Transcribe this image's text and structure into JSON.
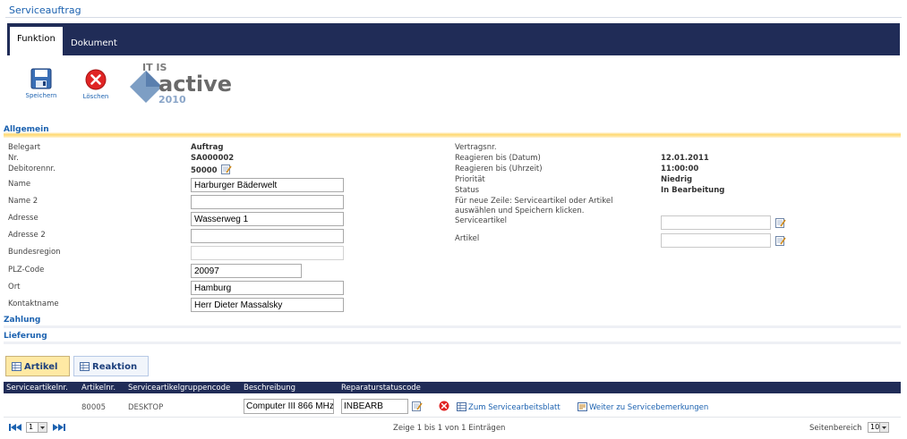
{
  "header": {
    "title": "Serviceauftrag"
  },
  "tabs": [
    {
      "label": "Funktion",
      "active": true
    },
    {
      "label": "Dokument",
      "active": false
    }
  ],
  "toolbar": {
    "save_label": "Speichern",
    "delete_label": "Löschen"
  },
  "logo": {
    "line1": "IT IS",
    "line2": "active",
    "line3": "2010"
  },
  "sections": {
    "general": "Allgemein",
    "payment": "Zahlung",
    "delivery": "Lieferung"
  },
  "left_fields": {
    "belegart": {
      "label": "Belegart",
      "value": "Auftrag"
    },
    "nr": {
      "label": "Nr.",
      "value": "SA000002"
    },
    "debitor": {
      "label": "Debitorennr.",
      "value": "50000"
    },
    "name": {
      "label": "Name",
      "value": "Harburger Bäderwelt"
    },
    "name2": {
      "label": "Name 2",
      "value": ""
    },
    "adresse": {
      "label": "Adresse",
      "value": "Wasserweg 1"
    },
    "adresse2": {
      "label": "Adresse 2",
      "value": ""
    },
    "bundesregion": {
      "label": "Bundesregion",
      "value": ""
    },
    "plz": {
      "label": "PLZ-Code",
      "value": "20097"
    },
    "ort": {
      "label": "Ort",
      "value": "Hamburg"
    },
    "kontakt": {
      "label": "Kontaktname",
      "value": "Herr Dieter Massalsky"
    }
  },
  "right_fields": {
    "vertrag": {
      "label": "Vertragsnr.",
      "value": ""
    },
    "reag_datum": {
      "label": "Reagieren bis (Datum)",
      "value": "12.01.2011"
    },
    "reag_zeit": {
      "label": "Reagieren bis (Uhrzeit)",
      "value": "11:00:00"
    },
    "prioritaet": {
      "label": "Priorität",
      "value": "Niedrig"
    },
    "status": {
      "label": "Status",
      "value": "In Bearbeitung"
    },
    "hint_line1": "Für neue Zeile: Serviceartikel oder Artikel",
    "hint_line2": "auswählen und Speichern klicken.",
    "serviceartikel": {
      "label": "Serviceartikel",
      "value": ""
    },
    "artikel": {
      "label": "Artikel",
      "value": ""
    }
  },
  "subtabs": [
    {
      "label": "Artikel",
      "active": true
    },
    {
      "label": "Reaktion",
      "active": false
    }
  ],
  "grid": {
    "columns": [
      "Serviceartikelnr.",
      "Artikelnr.",
      "Serviceartikelgruppencode",
      "Beschreibung",
      "Reparaturstatuscode"
    ],
    "rows": [
      {
        "serviceartikelnr": "",
        "artikelnr": "80005",
        "gruppencode": "DESKTOP",
        "beschreibung": "Computer III 866 MHz",
        "reparaturstatus": "INBEARB",
        "link_arbeitsblatt": "Zum Servicearbeitsblatt",
        "link_bemerkungen": "Weiter zu Servicebemerkungen"
      }
    ]
  },
  "pager": {
    "page": "1",
    "summary": "Zeige 1 bis 1 von 1 Einträgen",
    "range_label": "Seitenbereich",
    "range_value": "10"
  },
  "colors": {
    "nav": "#202c57",
    "link": "#1c62b0",
    "section_gradient": "#ffd86e",
    "active_subtab": "#ffe9a4"
  }
}
